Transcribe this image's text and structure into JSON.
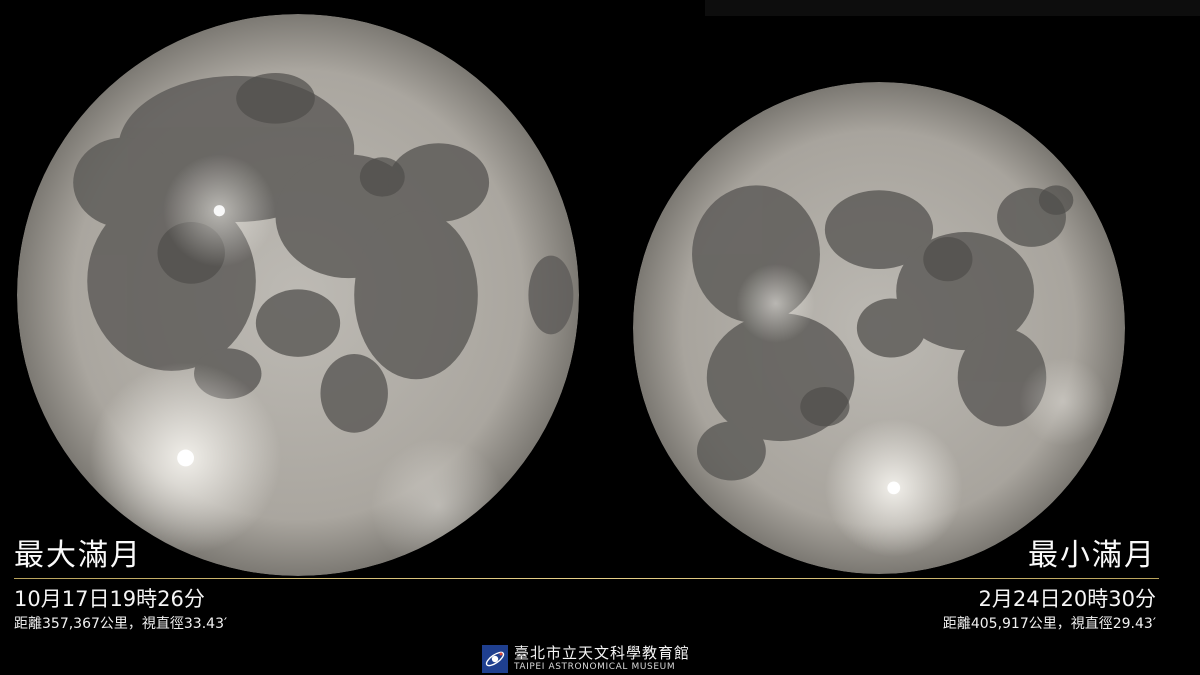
{
  "left": {
    "title": "最大滿月",
    "datetime": "10月17日19時26分",
    "details": "距離357,367公里，視直徑33.43′"
  },
  "right": {
    "title": "最小滿月",
    "datetime": "2月24日20時30分",
    "details": "距離405,917公里，視直徑29.43′"
  },
  "museum": {
    "name": "臺北市立天文科學教育館",
    "name_en": "TAIPEI ASTRONOMICAL MUSEUM",
    "logo_icon": "planet-orbit-logo-icon"
  },
  "colors": {
    "background": "#000000",
    "divider": "#d9c27a",
    "logo_blue": "#1f3f8f"
  }
}
